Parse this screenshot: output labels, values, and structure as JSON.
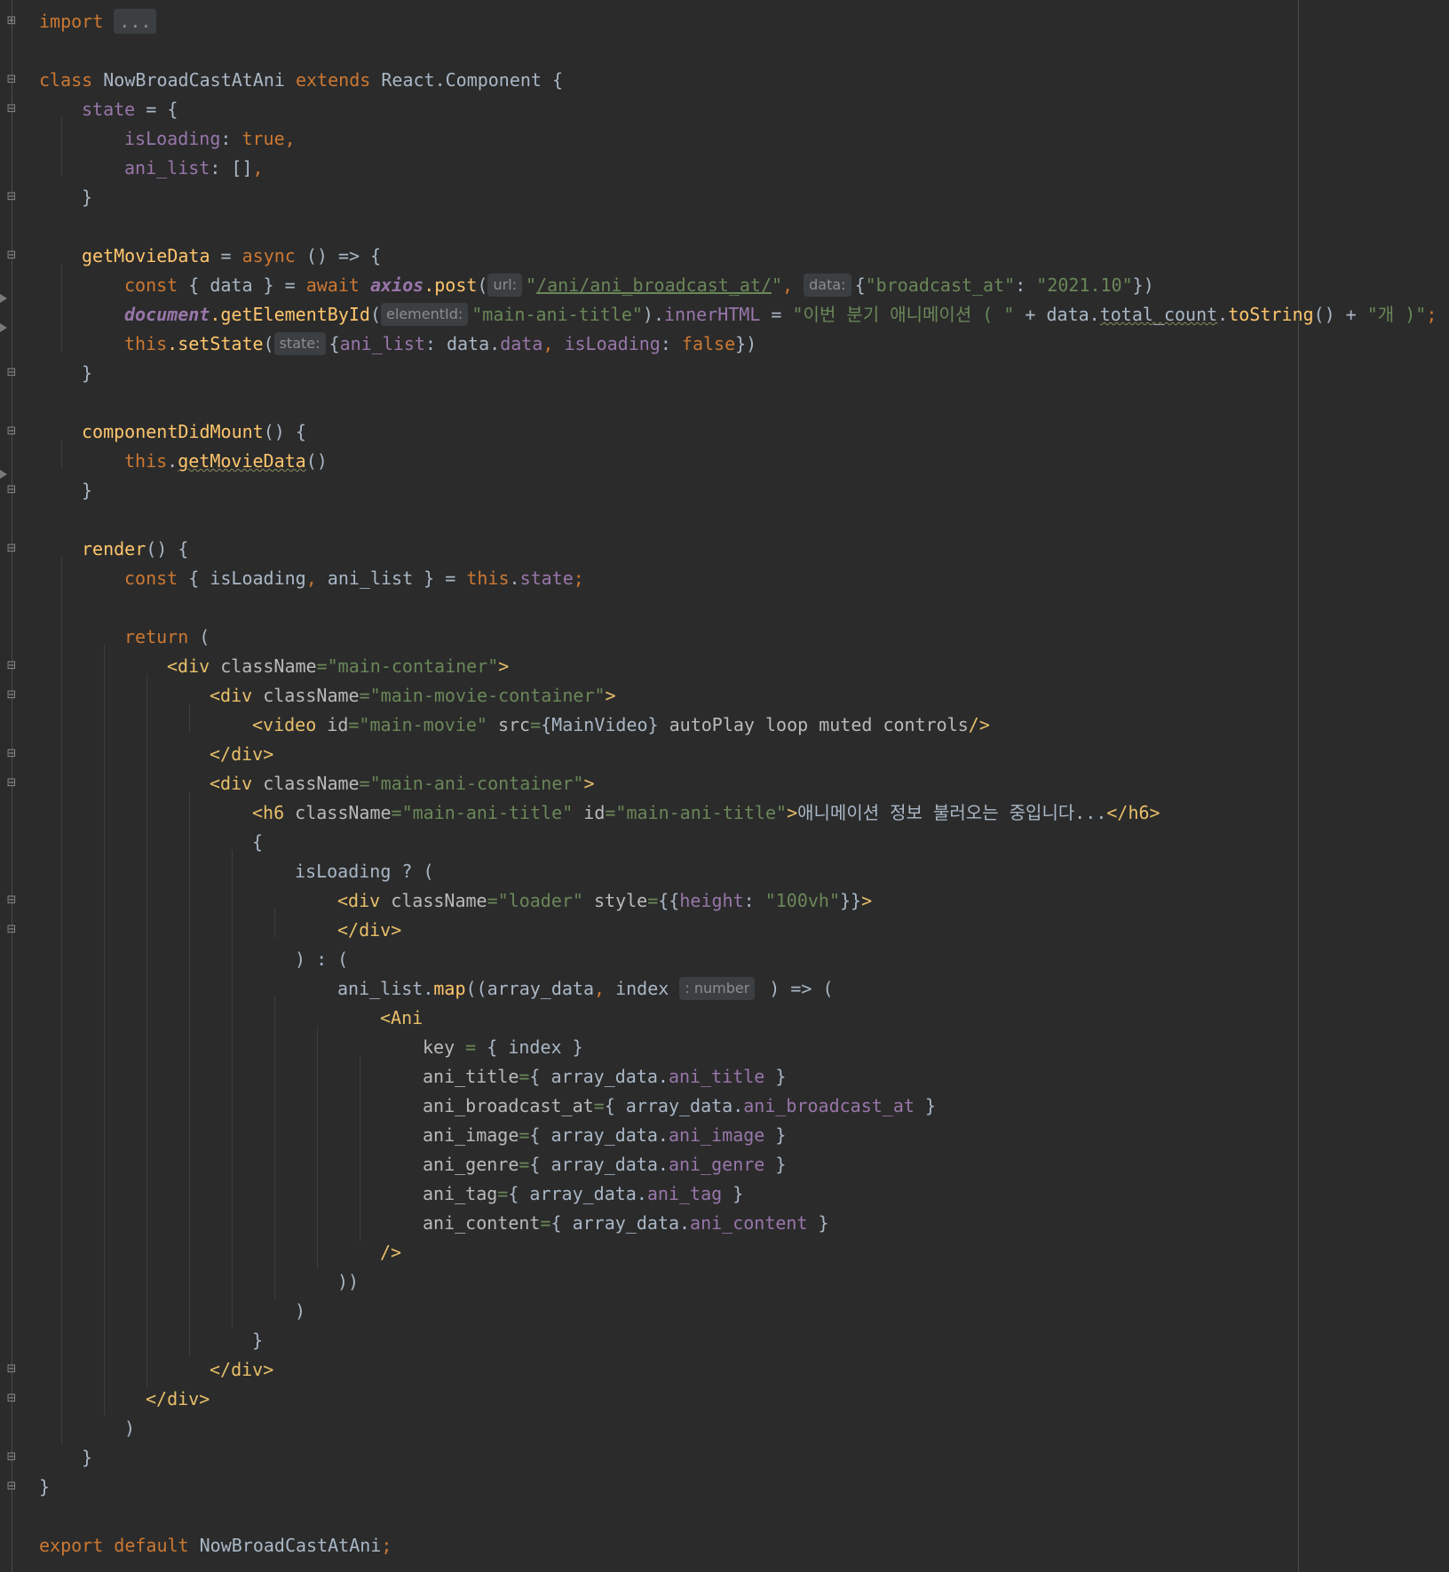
{
  "editor": {
    "lines": {
      "l1": {
        "import": "import",
        "folded": "..."
      },
      "l3": {
        "kw_class": "class",
        "class_name": "NowBroadCastAtAni",
        "kw_extends": "extends",
        "parent": "React.Component",
        "brace": "{"
      },
      "l4": {
        "state": "state",
        "op": " = {"
      },
      "l5": {
        "key": "isLoading",
        "colon": ": ",
        "val": "true",
        "comma": ","
      },
      "l6": {
        "key": "ani_list",
        "rest": ": []",
        "comma": ","
      },
      "l7": {
        "text": "}"
      },
      "l9": {
        "name": "getMovieData",
        "op": " = ",
        "async": "async",
        "rest": " () => {"
      },
      "l10": {
        "const": "const",
        "destruct": " { data } = ",
        "await": "await",
        "axios": "axios",
        "post": ".post",
        "paren": "(",
        "hint_url": "url:",
        "q1": "\"",
        "url": "/ani/ani_broadcast_at/",
        "q2": "\"",
        "comma": ", ",
        "hint_data": "data:",
        "obj_open": "{",
        "k": "\"broadcast_at\"",
        "colon": ": ",
        "v": "\"2021.10\"",
        "obj_close": "})"
      },
      "l11": {
        "doc": "document",
        "method": ".getElementById",
        "paren": "(",
        "hint": "elementId:",
        "arg": "\"main-ani-title\"",
        "close": ").",
        "inner": "innerHTML",
        "eq": " = ",
        "s1": "\"이번 분기 애니메이션 ( \"",
        "plus1": " + data.",
        "total": "total_count",
        "dot": ".",
        "tostr": "toString",
        "call": "() + ",
        "s2": "\"개 )\"",
        "semi": ";"
      },
      "l12": {
        "this": "this",
        "method": ".setState",
        "paren": "(",
        "hint": "state:",
        "open": "{",
        "k1": "ani_list",
        "sep1": ": data.",
        "k1v": "data",
        "comma": ", ",
        "k2": "isLoading",
        "sep2": ": ",
        "v2": "false",
        "close": "})"
      },
      "l13": {
        "text": "}"
      },
      "l15": {
        "name": "componentDidMount",
        "rest": "() {"
      },
      "l16": {
        "this": "this",
        "dot": ".",
        "call": "getMovieData",
        "paren": "()"
      },
      "l17": {
        "text": "}"
      },
      "l19": {
        "name": "render",
        "rest": "() {"
      },
      "l20": {
        "const": "const",
        "mid": " { isLoading",
        "comma": ",",
        "mid2": " ani_list } = ",
        "this": "this",
        "dot": ".",
        "state": "state",
        "semi": ";"
      },
      "l22": {
        "ret": "return",
        "rest": " ("
      },
      "l23": {
        "lt": "<div",
        "attr": " className",
        "eq": "=",
        "val": "\"main-container\"",
        "gt": ">"
      },
      "l24": {
        "lt": "<div",
        "attr": " className",
        "eq": "=",
        "val": "\"main-movie-container\"",
        "gt": ">"
      },
      "l25": {
        "lt": "<video",
        "a1": " id",
        "eq1": "=",
        "v1": "\"main-movie\"",
        "a2": " src",
        "eq2": "=",
        "v2": "{MainVideo}",
        "a3": " autoPlay loop muted controls",
        "gt": "/>"
      },
      "l26": {
        "text": "</div>"
      },
      "l27": {
        "lt": "<div",
        "attr": " className",
        "eq": "=",
        "val": "\"main-ani-container\"",
        "gt": ">"
      },
      "l28": {
        "lt": "<h6",
        "a1": " className",
        "eq1": "=",
        "v1": "\"main-ani-title\"",
        "a2": " id",
        "eq2": "=",
        "v2": "\"main-ani-title\"",
        "gt": ">",
        "content": "애니메이션 정보 불러오는 중입니다...",
        "close": "</h6>"
      },
      "l29": {
        "text": "{"
      },
      "l30": {
        "text": "isLoading ? ("
      },
      "l31": {
        "lt": "<div",
        "a1": " className",
        "eq1": "=",
        "v1": "\"loader\"",
        "a2": " style",
        "eq2": "=",
        "o": "{{",
        "k": "height",
        "c": ": ",
        "v": "\"100vh\"",
        "cl": "}}",
        "gt": ">"
      },
      "l32": {
        "text": "</div>"
      },
      "l33": {
        "text": ") : ("
      },
      "l34": {
        "a": "ani_list",
        "dot": ".",
        "map": "map",
        "args": "((array_data",
        "comma": ",",
        "idx": " index",
        "hint": ": number",
        "rest": " ) => ("
      },
      "l35": {
        "text": "<Ani"
      },
      "l36": {
        "a": "key",
        "eq": " = ",
        "v": "{ index }"
      },
      "l37": {
        "a": "ani_title",
        "eq": "=",
        "o": "{ array_data.",
        "p": "ani_title",
        "c": " }"
      },
      "l38": {
        "a": "ani_broadcast_at",
        "eq": "=",
        "o": "{ array_data.",
        "p": "ani_broadcast_at",
        "c": " }"
      },
      "l39": {
        "a": "ani_image",
        "eq": "=",
        "o": "{ array_data.",
        "p": "ani_image",
        "c": " }"
      },
      "l40": {
        "a": "ani_genre",
        "eq": "=",
        "o": "{ array_data.",
        "p": "ani_genre",
        "c": " }"
      },
      "l41": {
        "a": "ani_tag",
        "eq": "=",
        "o": "{ array_data.",
        "p": "ani_tag",
        "c": " }"
      },
      "l42": {
        "a": "ani_content",
        "eq": "=",
        "o": "{ array_data.",
        "p": "ani_content",
        "c": " }"
      },
      "l43": {
        "text": "/>"
      },
      "l44": {
        "text": "))"
      },
      "l45": {
        "text": ")"
      },
      "l46": {
        "text": "}"
      },
      "l47": {
        "text": "</div>"
      },
      "l48": {
        "text": "</div>"
      },
      "l49": {
        "text": ")"
      },
      "l50": {
        "text": "}"
      },
      "l51": {
        "text": "}"
      },
      "l53": {
        "export": "export",
        "default": "default",
        "name": "NowBroadCastAtAni",
        "semi": ";"
      }
    }
  }
}
